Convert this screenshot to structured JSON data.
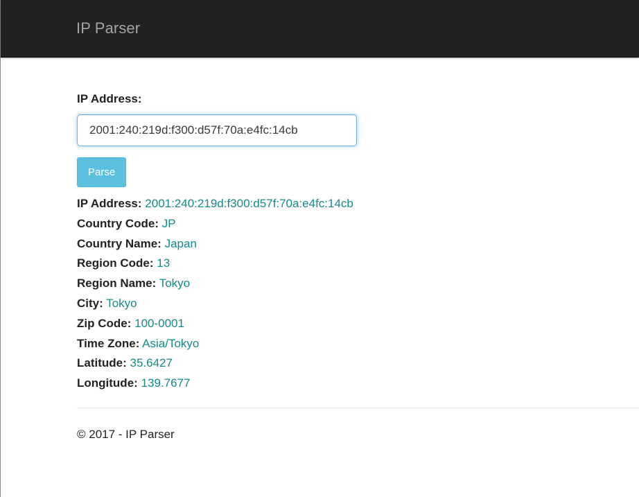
{
  "navbar": {
    "brand": "IP Parser"
  },
  "form": {
    "label": "IP Address:",
    "input_value": "2001:240:219d:f300:d57f:70a:e4fc:14cb",
    "parse_label": "Parse"
  },
  "results": [
    {
      "key": "IP Address:",
      "value": "2001:240:219d:f300:d57f:70a:e4fc:14cb"
    },
    {
      "key": "Country Code:",
      "value": "JP"
    },
    {
      "key": "Country Name:",
      "value": "Japan"
    },
    {
      "key": "Region Code:",
      "value": "13"
    },
    {
      "key": "Region Name:",
      "value": "Tokyo"
    },
    {
      "key": "City:",
      "value": "Tokyo"
    },
    {
      "key": "Zip Code:",
      "value": "100-0001"
    },
    {
      "key": "Time Zone:",
      "value": "Asia/Tokyo"
    },
    {
      "key": "Latitude:",
      "value": "35.6427"
    },
    {
      "key": "Longitude:",
      "value": "139.7677"
    }
  ],
  "footer": {
    "text": "© 2017 - IP Parser"
  },
  "colors": {
    "navbar_bg": "#222222",
    "brand": "#a4a4a4",
    "value_text": "#148a8a",
    "button_bg": "#5bc0de",
    "input_focus_border": "#66afe9"
  }
}
